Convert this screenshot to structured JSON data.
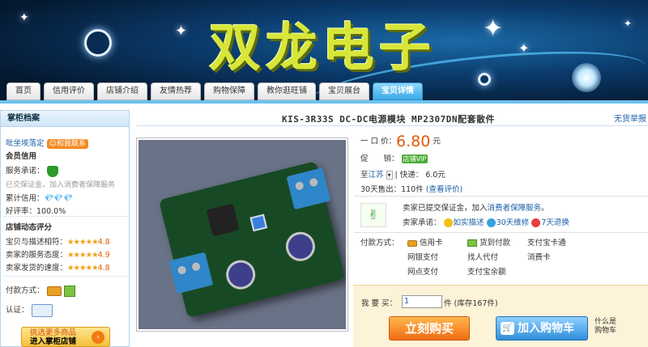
{
  "banner": {
    "title": "双龙电子",
    "nav": [
      "首页",
      "信用评价",
      "店铺介绍",
      "友情热荐",
      "购物保障",
      "教你逛旺铺",
      "宝贝展台",
      "宝贝详情"
    ],
    "active_tab": "宝贝详情"
  },
  "sidebar": {
    "header": "掌柜档案",
    "seller": "吡坐埃落定",
    "wangwang": "和我联系",
    "section_credit": "会员信用",
    "service_label": "服务承诺：",
    "deposit_note": "已交保证金，加入消费者保障服务",
    "credit_label": "累计信用：",
    "credit_diamonds": "💎💎💎",
    "goodrate_label": "好评率：",
    "goodrate": "100.0%",
    "section_rating": "店铺动态评分",
    "ratings": [
      {
        "label": "宝贝与描述相符：",
        "stars": "★★★★★",
        "score": "4.8"
      },
      {
        "label": "卖家的服务态度：",
        "stars": "★★★★★",
        "score": "4.9"
      },
      {
        "label": "卖家发货的速度：",
        "stars": "★★★★★",
        "score": "4.8"
      }
    ],
    "payment_label": "付款方式：",
    "cert_label": "认证：",
    "enter_line1": "挑选更多商品",
    "enter_line2": "进入掌柜店铺"
  },
  "product": {
    "title": "KIS-3R33S DC-DC电源模块 MP2307DN配套散件",
    "report": "无货举报",
    "price_label": "一 口 价：",
    "price": "6.80",
    "price_unit": "元",
    "promo_label": "促　　销：",
    "promo_badge": "店铺VIP",
    "ship_to": "至",
    "ship_region": "江苏",
    "ship_express": "快递：",
    "ship_fee": "6.0元",
    "sold_30d": "30天售出：110件",
    "review_link": "(查看评价)",
    "guarantee_text": "卖家已提交保证金，加入",
    "guarantee_link": "消费者保障服务",
    "guarantee_end": "。",
    "promise_label": "卖家承诺：",
    "promises": [
      "如实描述",
      "30天维修",
      "7天退换"
    ]
  },
  "payment": {
    "label": "付款方式：",
    "methods": [
      "信用卡",
      "货到付款",
      "支付宝卡通",
      "网银支付",
      "找人代付",
      "消费卡",
      "网点支付",
      "支付宝余额"
    ]
  },
  "buy": {
    "qty_label": "我 要 买：",
    "qty": "1",
    "stock": "件 (库存167件)",
    "buy_now": "立刻购买",
    "add_cart": "加入购物车",
    "what_is": "什么是",
    "cart_word": "购物车"
  }
}
